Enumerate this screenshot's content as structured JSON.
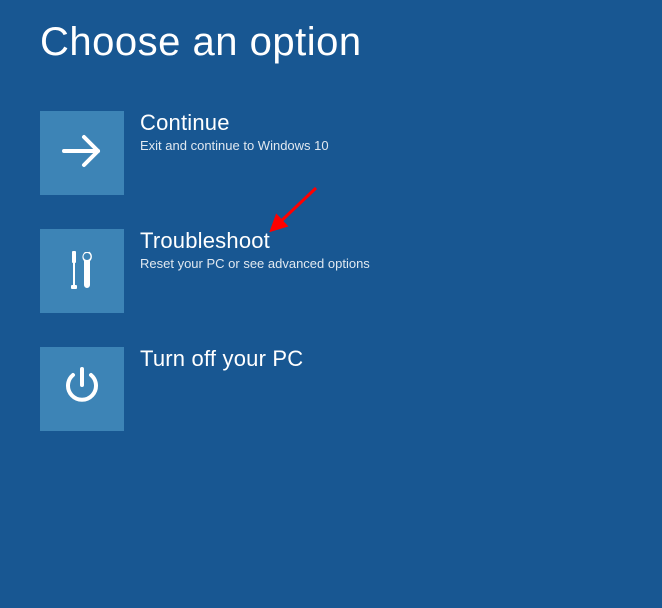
{
  "title": "Choose an option",
  "options": [
    {
      "title": "Continue",
      "description": "Exit and continue to Windows 10"
    },
    {
      "title": "Troubleshoot",
      "description": "Reset your PC or see advanced options"
    },
    {
      "title": "Turn off your PC",
      "description": ""
    }
  ],
  "colors": {
    "background": "#185792",
    "tile": "#3d84b6",
    "text": "#ffffff",
    "arrow": "#ff0000"
  }
}
